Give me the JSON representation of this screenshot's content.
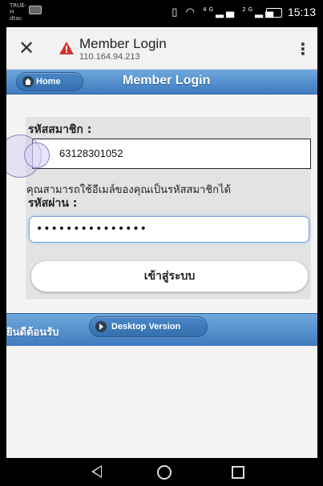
{
  "status_bar": {
    "carrier": "TRUE-H dtac",
    "network_4g": "4G",
    "network_2g": "2G",
    "time": "15:13"
  },
  "browser": {
    "title": "Member Login",
    "url": "110.164.94.213"
  },
  "header": {
    "home_label": "Home",
    "title": "Member Login"
  },
  "form": {
    "member_label": "รหัสสมาชิก :",
    "member_value": "63128301052",
    "hint": "คุณสามารถใช้อีเมล์ของคุณเป็นรหัสสมาชิกได้",
    "password_label": "รหัสผ่าน :",
    "password_value": "•••••••••••••••",
    "login_label": "เข้าสู่ระบบ"
  },
  "footer": {
    "welcome": "ยินดีต้อนรับ",
    "desktop_label": "Desktop Version"
  },
  "colors": {
    "header_blue": "#4f8fd0",
    "button_blue": "#3f7cc0"
  },
  "icons": {
    "close": "close-icon",
    "warning": "warning-icon",
    "menu": "more-vert-icon",
    "home": "home-icon",
    "desktop": "arrow-right-circle-icon"
  }
}
